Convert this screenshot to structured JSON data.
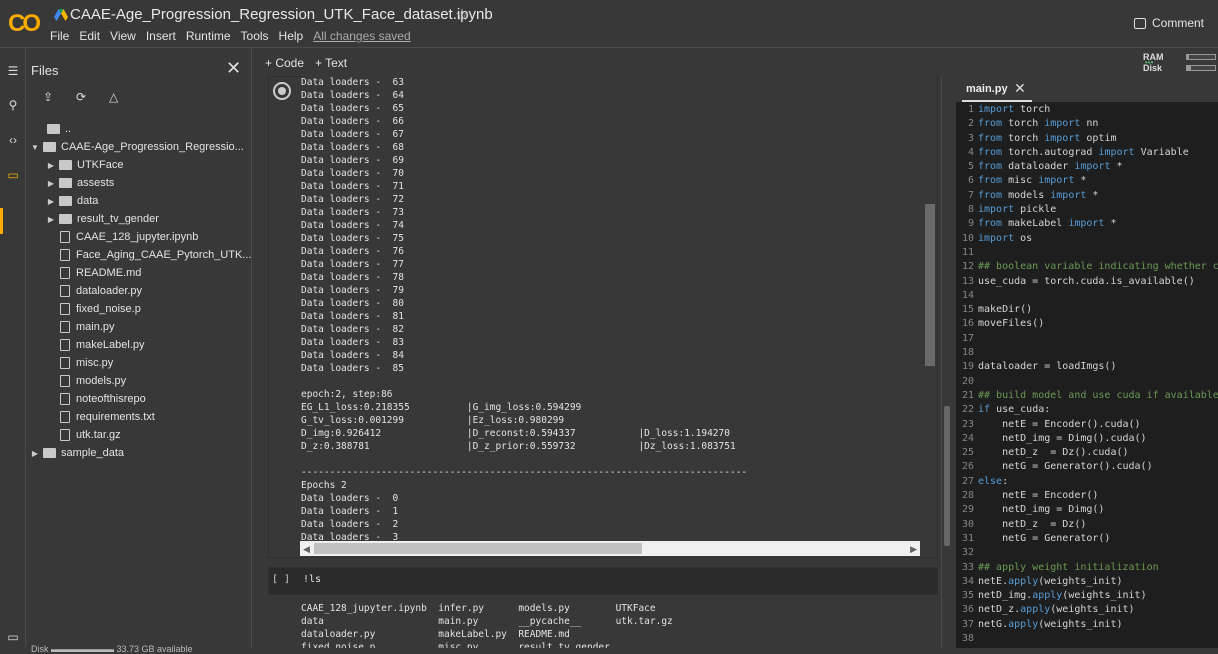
{
  "header": {
    "logo": "CO",
    "title": "CAAE-Age_Progression_Regression_UTK_Face_dataset.ipynb",
    "menu": [
      "File",
      "Edit",
      "View",
      "Insert",
      "Runtime",
      "Tools",
      "Help"
    ],
    "saved_status": "All changes saved",
    "comment_label": "Comment"
  },
  "resources": {
    "ram_label": "RAM",
    "disk_label": "Disk",
    "ram_fraction": 0.08,
    "disk_fraction": 0.15
  },
  "files_panel": {
    "title": "Files",
    "tree": [
      {
        "name": "..",
        "kind": "up",
        "depth": 0
      },
      {
        "name": "CAAE-Age_Progression_Regressio...",
        "kind": "folder-open",
        "depth": 0
      },
      {
        "name": "UTKFace",
        "kind": "folder",
        "depth": 1
      },
      {
        "name": "assests",
        "kind": "folder",
        "depth": 1
      },
      {
        "name": "data",
        "kind": "folder",
        "depth": 1
      },
      {
        "name": "result_tv_gender",
        "kind": "folder",
        "depth": 1
      },
      {
        "name": "CAAE_128_jupyter.ipynb",
        "kind": "file",
        "depth": 1
      },
      {
        "name": "Face_Aging_CAAE_Pytorch_UTK...",
        "kind": "file",
        "depth": 1
      },
      {
        "name": "README.md",
        "kind": "file",
        "depth": 1
      },
      {
        "name": "dataloader.py",
        "kind": "file",
        "depth": 1
      },
      {
        "name": "fixed_noise.p",
        "kind": "file",
        "depth": 1
      },
      {
        "name": "main.py",
        "kind": "file",
        "depth": 1
      },
      {
        "name": "makeLabel.py",
        "kind": "file",
        "depth": 1
      },
      {
        "name": "misc.py",
        "kind": "file",
        "depth": 1
      },
      {
        "name": "models.py",
        "kind": "file",
        "depth": 1
      },
      {
        "name": "noteofthisrepo",
        "kind": "file",
        "depth": 1
      },
      {
        "name": "requirements.txt",
        "kind": "file",
        "depth": 1
      },
      {
        "name": "utk.tar.gz",
        "kind": "file",
        "depth": 1
      },
      {
        "name": "sample_data",
        "kind": "folder",
        "depth": 0
      }
    ],
    "disk_label": "Disk",
    "disk_available": "33.73 GB available"
  },
  "toolbar": {
    "add_code": "+ Code",
    "add_text": "+ Text"
  },
  "cell1": {
    "output": "Data loaders -  63\nData loaders -  64\nData loaders -  65\nData loaders -  66\nData loaders -  67\nData loaders -  68\nData loaders -  69\nData loaders -  70\nData loaders -  71\nData loaders -  72\nData loaders -  73\nData loaders -  74\nData loaders -  75\nData loaders -  76\nData loaders -  77\nData loaders -  78\nData loaders -  79\nData loaders -  80\nData loaders -  81\nData loaders -  82\nData loaders -  83\nData loaders -  84\nData loaders -  85\n\nepoch:2, step:86\nEG_L1_loss:0.218355          |G_img_loss:0.594299\nG_tv_loss:0.001299           |Ez_loss:0.980299\nD_img:0.926412               |D_reconst:0.594337           |D_loss:1.194270\nD_z:0.388781                 |D_z_prior:0.559732           |Dz_loss:1.083751\n\n------------------------------------------------------------------------------\nEpochs 2\nData loaders -  0\nData loaders -  1\nData loaders -  2\nData loaders -  3"
  },
  "cell2": {
    "bracket": "[ ]",
    "command": "!ls",
    "output": "CAAE_128_jupyter.ipynb  infer.py      models.py        UTKFace\ndata                    main.py       __pycache__      utk.tar.gz\ndataloader.py           makeLabel.py  README.md\nfixed_noise.p           misc.py       result_tv_gender"
  },
  "editor": {
    "tab": "main.py",
    "lines": [
      [
        [
          "kw",
          "import"
        ],
        [
          "tx",
          " torch"
        ]
      ],
      [
        [
          "kw",
          "from"
        ],
        [
          "tx",
          " torch "
        ],
        [
          "kw",
          "import"
        ],
        [
          "tx",
          " nn"
        ]
      ],
      [
        [
          "kw",
          "from"
        ],
        [
          "tx",
          " torch "
        ],
        [
          "kw",
          "import"
        ],
        [
          "tx",
          " optim"
        ]
      ],
      [
        [
          "kw",
          "from"
        ],
        [
          "tx",
          " torch.autograd "
        ],
        [
          "kw",
          "import"
        ],
        [
          "tx",
          " Variable"
        ]
      ],
      [
        [
          "kw",
          "from"
        ],
        [
          "tx",
          " dataloader "
        ],
        [
          "kw",
          "import"
        ],
        [
          "tx",
          " *"
        ]
      ],
      [
        [
          "kw",
          "from"
        ],
        [
          "tx",
          " misc "
        ],
        [
          "kw",
          "import"
        ],
        [
          "tx",
          " *"
        ]
      ],
      [
        [
          "kw",
          "from"
        ],
        [
          "tx",
          " models "
        ],
        [
          "kw",
          "import"
        ],
        [
          "tx",
          " *"
        ]
      ],
      [
        [
          "kw",
          "import"
        ],
        [
          "tx",
          " pickle"
        ]
      ],
      [
        [
          "kw",
          "from"
        ],
        [
          "tx",
          " makeLabel "
        ],
        [
          "kw",
          "import"
        ],
        [
          "tx",
          " *"
        ]
      ],
      [
        [
          "kw",
          "import"
        ],
        [
          "tx",
          " os"
        ]
      ],
      [],
      [
        [
          "cm",
          "## boolean variable indicating whether cuda"
        ]
      ],
      [
        [
          "tx",
          "use_cuda = torch.cuda.is_available()"
        ]
      ],
      [],
      [
        [
          "tx",
          "makeDir()"
        ]
      ],
      [
        [
          "tx",
          "moveFiles()"
        ]
      ],
      [],
      [],
      [
        [
          "tx",
          "dataloader = loadImgs()"
        ]
      ],
      [],
      [
        [
          "cm",
          "## build model and use cuda if available"
        ]
      ],
      [
        [
          "kw",
          "if"
        ],
        [
          "tx",
          " use_cuda:"
        ]
      ],
      [
        [
          "tx",
          "    netE = Encoder().cuda()"
        ]
      ],
      [
        [
          "tx",
          "    netD_img = Dimg().cuda()"
        ]
      ],
      [
        [
          "tx",
          "    netD_z  = Dz().cuda()"
        ]
      ],
      [
        [
          "tx",
          "    netG = Generator().cuda()"
        ]
      ],
      [
        [
          "kw",
          "else"
        ],
        [
          "tx",
          ":"
        ]
      ],
      [
        [
          "tx",
          "    netE = Encoder()"
        ]
      ],
      [
        [
          "tx",
          "    netD_img = Dimg()"
        ]
      ],
      [
        [
          "tx",
          "    netD_z  = Dz()"
        ]
      ],
      [
        [
          "tx",
          "    netG = Generator()"
        ]
      ],
      [],
      [
        [
          "cm",
          "## apply weight initialization"
        ]
      ],
      [
        [
          "tx",
          "netE."
        ],
        [
          "kw",
          "apply"
        ],
        [
          "tx",
          "(weights_init)"
        ]
      ],
      [
        [
          "tx",
          "netD_img."
        ],
        [
          "kw",
          "apply"
        ],
        [
          "tx",
          "(weights_init)"
        ]
      ],
      [
        [
          "tx",
          "netD_z."
        ],
        [
          "kw",
          "apply"
        ],
        [
          "tx",
          "(weights_init)"
        ]
      ],
      [
        [
          "tx",
          "netG."
        ],
        [
          "kw",
          "apply"
        ],
        [
          "tx",
          "(weights_init)"
        ]
      ],
      []
    ]
  }
}
